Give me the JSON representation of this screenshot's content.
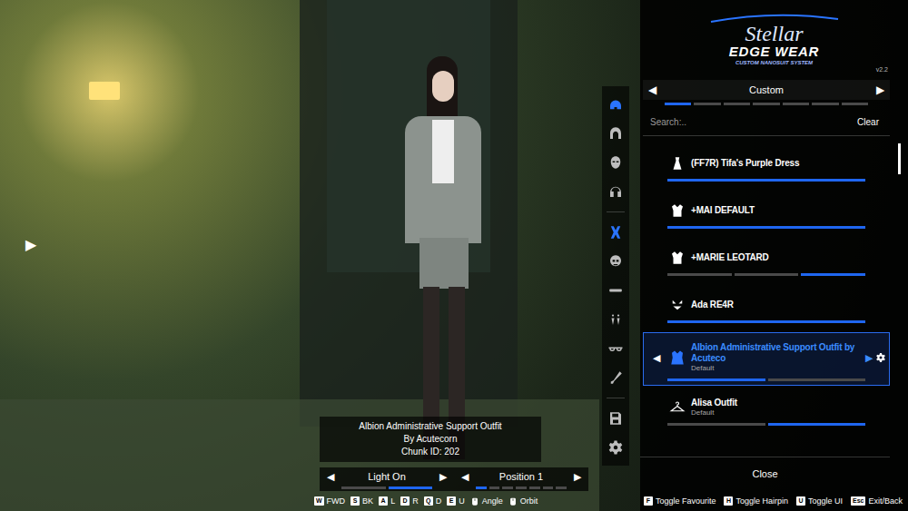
{
  "logo": {
    "script": "Stellar",
    "title": "EDGE WEAR",
    "subtitle": "CUSTOM NANOSUIT SYSTEM",
    "version": "v2.2"
  },
  "side_arrow": "▶",
  "category": {
    "prev": "◀",
    "label": "Custom",
    "next": "▶",
    "segments": [
      true,
      false,
      false,
      false,
      false,
      false,
      false
    ]
  },
  "search": {
    "placeholder": "Search:..",
    "clear": "Clear"
  },
  "head_tabs": [
    {
      "selected": true
    },
    {
      "selected": false
    },
    {
      "selected": false
    },
    {
      "selected": false
    }
  ],
  "part_tabs": [
    {
      "selected": true
    },
    {
      "selected": false
    },
    {
      "selected": false
    },
    {
      "selected": false
    },
    {
      "selected": false
    },
    {
      "selected": false
    }
  ],
  "outfits": [
    {
      "name": "(FF7R) Tifa's Purple Dress",
      "selected": false,
      "segments": [
        true
      ]
    },
    {
      "name": "+MAI DEFAULT",
      "selected": false,
      "segments": [
        true
      ]
    },
    {
      "name": "+MARIE LEOTARD",
      "selected": false,
      "segments": [
        false,
        false,
        true
      ]
    },
    {
      "name": "Ada RE4R",
      "selected": false,
      "segments": [
        true
      ]
    },
    {
      "name": "Albion Administrative Support Outfit by Acuteco",
      "subtitle": "Default",
      "selected": true,
      "arrows": [
        "◀",
        "▶"
      ],
      "segments": [
        true,
        false
      ]
    },
    {
      "name": "Alisa Outfit",
      "subtitle": "Default",
      "selected": false,
      "segments": [
        false,
        true
      ]
    }
  ],
  "info": {
    "name": "Albion Administrative Support Outfit",
    "author": "By Acutecorn",
    "chunk": "Chunk ID: 202"
  },
  "controls": [
    {
      "prev": "◀",
      "label": "Light On",
      "next": "▶",
      "segments": [
        false,
        true
      ]
    },
    {
      "prev": "◀",
      "label": "Position 1",
      "next": "▶",
      "segments": [
        true,
        false,
        false,
        false,
        false,
        false,
        false
      ]
    }
  ],
  "hints_left": [
    {
      "kind": "key",
      "key": "W",
      "label": "FWD"
    },
    {
      "kind": "key",
      "key": "S",
      "label": "BK"
    },
    {
      "kind": "key",
      "key": "A",
      "label": "L"
    },
    {
      "kind": "key",
      "key": "D",
      "label": "R"
    },
    {
      "kind": "key",
      "key": "Q",
      "label": "D"
    },
    {
      "kind": "key",
      "key": "E",
      "label": "U"
    },
    {
      "kind": "mouse",
      "label": "Angle"
    },
    {
      "kind": "mouse",
      "label": "Orbit"
    }
  ],
  "hints_right": [
    {
      "key": "F",
      "label": "Toggle Favourite"
    },
    {
      "key": "H",
      "label": "Toggle Hairpin"
    },
    {
      "key": "U",
      "label": "Toggle UI"
    },
    {
      "key": "Esc",
      "label": "Exit/Back"
    }
  ],
  "close": "Close"
}
